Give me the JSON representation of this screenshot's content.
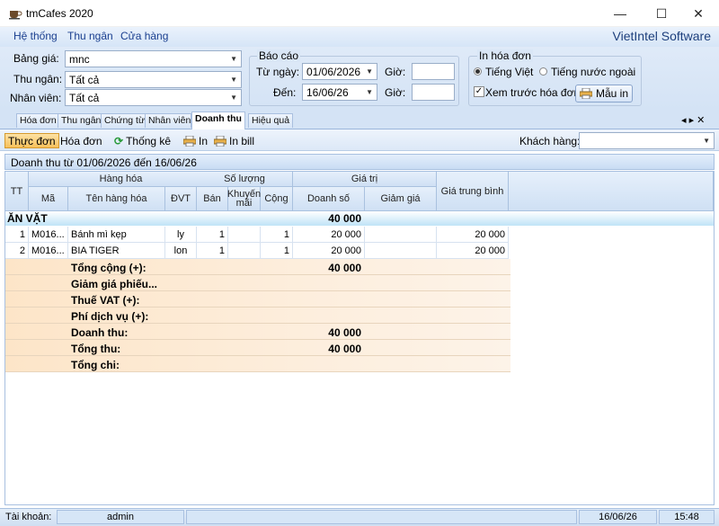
{
  "window": {
    "title": "tmCafes 2020",
    "minimize": "—",
    "maximize": "☐",
    "close": "✕"
  },
  "menu": {
    "items": [
      "Hệ thống",
      "Thu ngân",
      "Cửa hàng"
    ],
    "brand": "VietIntel Software"
  },
  "filters": {
    "bang_gia_label": "Bảng giá:",
    "bang_gia_value": "mnc",
    "thu_ngan_label": "Thu ngân:",
    "thu_ngan_value": "Tất cả",
    "nhan_vien_label": "Nhân viên:",
    "nhan_vien_value": "Tất cả"
  },
  "bao_cao": {
    "legend": "Báo cáo",
    "tu_ngay_label": "Từ ngày:",
    "tu_ngay_value": "01/06/2026",
    "den_label": "Đến:",
    "den_value": "16/06/26",
    "gio_label": "Giờ:"
  },
  "in_hoa_don": {
    "legend": "In hóa đơn",
    "lang_vn": "Tiếng Việt",
    "lang_foreign": "Tiếng nước ngoài",
    "preview_label": "Xem trước hóa đơn",
    "preview_checked": "✓",
    "mau_in": "Mẫu in"
  },
  "tabs": [
    "Hóa đơn",
    "Thu ngân",
    "Chứng từ",
    "Nhân viên",
    "Doanh thu",
    "Hiệu quả"
  ],
  "tab_nav": "◂ ▸ ✕",
  "toolbar": {
    "thuc_don": "Thực đơn",
    "hoa_don": "Hóa đơn",
    "thong_ke": "Thống kê",
    "in": "In",
    "in_bill": "In bill",
    "khach_hang_label": "Khách hàng:"
  },
  "report": {
    "title": "Doanh thu từ 01/06/2026 đến 16/06/26"
  },
  "grid": {
    "headers": {
      "tt": "TT",
      "hang_hoa": "Hàng hóa",
      "ma": "Mã",
      "ten": "Tên hàng hóa",
      "dvt": "ĐVT",
      "so_luong": "Số lượng",
      "ban": "Bán",
      "khuyen_mai": "Khuyến mãi",
      "cong": "Cộng",
      "gia_tri": "Giá trị",
      "doanh_so": "Doanh số",
      "giam_gia": "Giảm giá",
      "gia_tb": "Giá trung bình"
    },
    "group": {
      "name": "ĂN VẶT",
      "total": "40 000"
    },
    "rows": [
      {
        "tt": "1",
        "ma": "M016...",
        "ten": "Bánh mì kẹp",
        "dvt": "ly",
        "ban": "1",
        "km": "",
        "cong": "1",
        "doanh_so": "20 000",
        "giam_gia": "",
        "gia_tb": "20 000"
      },
      {
        "tt": "2",
        "ma": "M016...",
        "ten": "BIA TIGER",
        "dvt": "lon",
        "ban": "1",
        "km": "",
        "cong": "1",
        "doanh_so": "20 000",
        "giam_gia": "",
        "gia_tb": "20 000"
      }
    ],
    "summary": [
      {
        "label": "Tổng cộng (+):",
        "value": "40 000"
      },
      {
        "label": "Giảm giá phiếu...",
        "value": ""
      },
      {
        "label": "Thuế VAT (+):",
        "value": ""
      },
      {
        "label": "Phí dịch vụ (+):",
        "value": ""
      },
      {
        "label": "Doanh thu:",
        "value": "40 000"
      },
      {
        "label": "Tổng thu:",
        "value": "40 000"
      },
      {
        "label": "Tổng chi:",
        "value": ""
      }
    ]
  },
  "status": {
    "account_label": "Tài khoản:",
    "account": "admin",
    "date": "16/06/26",
    "time": "15:48"
  }
}
